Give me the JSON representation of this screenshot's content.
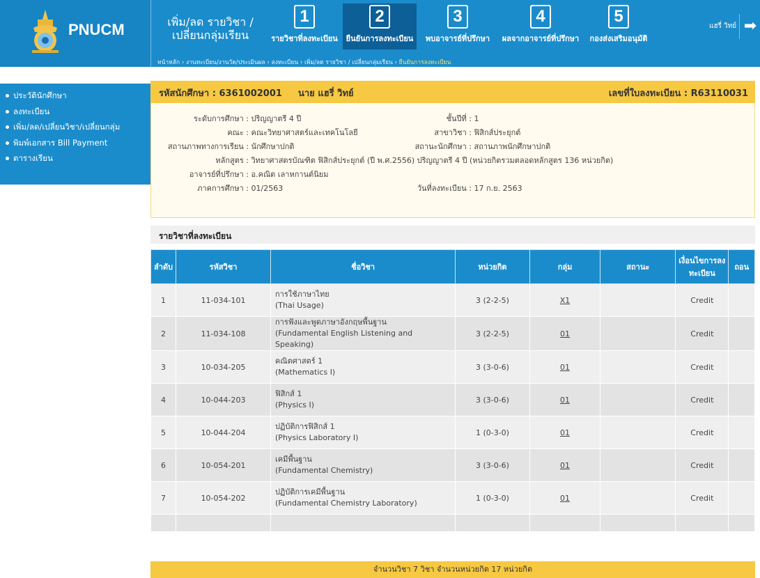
{
  "app": {
    "logo_text": "PNUCM"
  },
  "header": {
    "page_title": "เพิ่ม/ลด รายวิชา / เปลี่ยนกลุ่มเรียน",
    "user": "แฮรี่ วิทย์",
    "colors": {
      "primary": "#1b8ccb",
      "active_step": "#0d5f97",
      "accent": "#f7c942"
    }
  },
  "steps": [
    {
      "num": "1",
      "label": "รายวิชาที่ลงทะเบียน"
    },
    {
      "num": "2",
      "label": "ยืนยันการลงทะเบียน",
      "active": true
    },
    {
      "num": "3",
      "label": "พบอาจารย์ที่ปรึกษา"
    },
    {
      "num": "4",
      "label": "ผลจากอาจารย์ที่ปรึกษา"
    },
    {
      "num": "5",
      "label": "กองส่งเสริมอนุมัติ"
    }
  ],
  "breadcrumb": {
    "path": "หน้าหลัก › งานทะเบียน/งานวัด/ประเมินผล › ลงทะเบียน › เพิ่ม/ลด รายวิชา / เปลี่ยนกลุ่มเรียน › ",
    "current": "ยืนยันการลงทะเบียน"
  },
  "sidebar": {
    "items": [
      {
        "label": "ประวัตินักศึกษา"
      },
      {
        "label": "ลงทะเบียน"
      },
      {
        "label": "เพิ่ม/ลด/เปลี่ยนวิชา/เปลี่ยนกลุ่ม"
      },
      {
        "label": "พิมพ์เอกสาร Bill Payment"
      },
      {
        "label": "ตารางเรียน"
      }
    ]
  },
  "student": {
    "id_text": "รหัสนักศึกษา : 6361002001",
    "name_text": "นาย แฮรี่ วิทย์",
    "reg_text": "เลขที่ใบลงทะเบียน : R63110031",
    "left": [
      {
        "label": "ระดับการศึกษา :",
        "value": "ปริญญาตรี 4 ปี"
      },
      {
        "label": "คณะ :",
        "value": "คณะวิทยาศาสตร์และเทคโนโลยี"
      },
      {
        "label": "สถานภาพทางการเรียน :",
        "value": "นักศึกษาปกติ"
      },
      {
        "label": "หลักสูตร :",
        "value": "วิทยาศาสตรบัณฑิต ฟิสิกส์ประยุกต์ (ปี พ.ศ.2556) ปริญญาตรี 4 ปี (หน่วยกิตรวมตลอดหลักสูตร 136 หน่วยกิต)"
      },
      {
        "label": "อาจารย์ที่ปรึกษา :",
        "value": "อ.คณิต เลาหกานต์นิยม"
      },
      {
        "label": "ภาคการศึกษา :",
        "value": "01/2563"
      }
    ],
    "right": [
      {
        "label": "ชั้นปีที่ :",
        "value": "1"
      },
      {
        "label": "สาขาวิชา :",
        "value": "ฟิสิกส์ประยุกต์"
      },
      {
        "label": "สถานะนักศึกษา :",
        "value": "สถานภาพนักศึกษาปกติ"
      },
      {
        "label": "วันที่ลงทะเบียน :",
        "value": "17 ก.ย. 2563"
      }
    ]
  },
  "courses": {
    "section_title": "รายวิชาที่ลงทะเบียน",
    "headers": [
      "ลำดับ",
      "รหัสวิชา",
      "ชื่อวิชา",
      "หน่วยกิต",
      "กลุ่ม",
      "สถานะ",
      "เงื่อนไขการลงทะเบียน",
      "ถอน"
    ],
    "rows": [
      {
        "no": "1",
        "code": "11-034-101",
        "name_th": "การใช้ภาษาไทย",
        "name_en": "(Thai Usage)",
        "credit": "3 (2-2-5)",
        "group": "X1",
        "status": "",
        "cond": "Credit"
      },
      {
        "no": "2",
        "code": "11-034-108",
        "name_th": "การฟังและพูดภาษาอังกฤษพื้นฐาน",
        "name_en": "(Fundamental English Listening and Speaking)",
        "credit": "3 (2-2-5)",
        "group": "01",
        "status": "",
        "cond": "Credit"
      },
      {
        "no": "3",
        "code": "10-034-205",
        "name_th": "คณิตศาสตร์ 1",
        "name_en": "(Mathematics I)",
        "credit": "3 (3-0-6)",
        "group": "01",
        "status": "",
        "cond": "Credit"
      },
      {
        "no": "4",
        "code": "10-044-203",
        "name_th": "ฟิสิกส์ 1",
        "name_en": "(Physics I)",
        "credit": "3 (3-0-6)",
        "group": "01",
        "status": "",
        "cond": "Credit"
      },
      {
        "no": "5",
        "code": "10-044-204",
        "name_th": "ปฏิบัติการฟิสิกส์ 1",
        "name_en": "(Physics Laboratory I)",
        "credit": "1 (0-3-0)",
        "group": "01",
        "status": "",
        "cond": "Credit"
      },
      {
        "no": "6",
        "code": "10-054-201",
        "name_th": "เคมีพื้นฐาน",
        "name_en": "(Fundamental Chemistry)",
        "credit": "3 (3-0-6)",
        "group": "01",
        "status": "",
        "cond": "Credit"
      },
      {
        "no": "7",
        "code": "10-054-202",
        "name_th": "ปฏิบัติการเคมีพื้นฐาน",
        "name_en": "(Fundamental Chemistry Laboratory)",
        "credit": "1 (0-3-0)",
        "group": "01",
        "status": "",
        "cond": "Credit"
      }
    ],
    "summary": "จำนวนวิชา 7 วิชา จำนวนหน่วยกิต 17 หน่วยกิต"
  }
}
